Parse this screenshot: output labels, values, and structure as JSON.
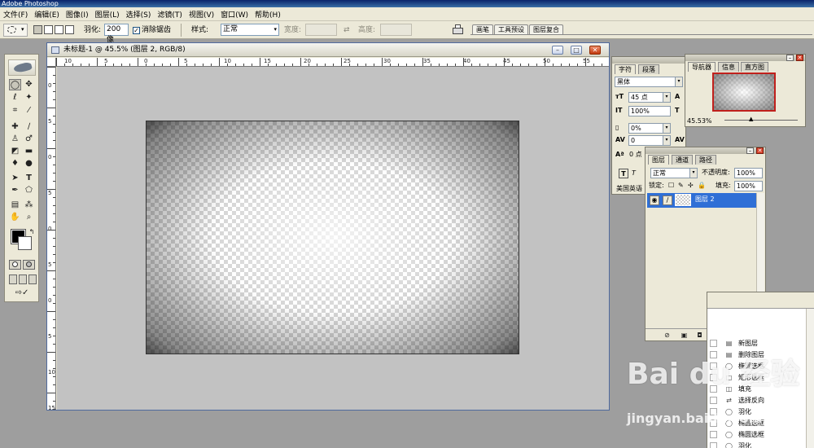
{
  "app": {
    "title": "Adobe Photoshop"
  },
  "menu": [
    "文件(F)",
    "编辑(E)",
    "图像(I)",
    "图层(L)",
    "选择(S)",
    "滤镜(T)",
    "视图(V)",
    "窗口(W)",
    "帮助(H)"
  ],
  "options": {
    "feather_label": "羽化:",
    "feather_value": "200 像",
    "antialias_label": "消除锯齿",
    "style_label": "样式:",
    "style_value": "正常",
    "width_label": "宽度:",
    "height_label": "高度:"
  },
  "palette_well": [
    "画笔",
    "工具预设",
    "图层复合"
  ],
  "document": {
    "title": "未标题-1 @ 45.5% (图层 2, RGB/8)",
    "ruler_h": [
      "10",
      "5",
      "0",
      "5",
      "10",
      "15",
      "20",
      "25",
      "30",
      "35",
      "40",
      "45",
      "50",
      "55",
      "60"
    ],
    "ruler_v": [
      "0",
      "5",
      "0",
      "5",
      "0",
      "5",
      "0",
      "5",
      "10",
      "15",
      "20"
    ]
  },
  "character": {
    "tabs": [
      "字符",
      "段落"
    ],
    "font": "黑体",
    "size": "45 点",
    "scale": "100%",
    "tracking_a": "0%",
    "tracking_b": "0",
    "kerning": "度量标准",
    "baseline": "0 点",
    "language": "美国英语"
  },
  "navigator": {
    "tabs": [
      "导航器",
      "信息",
      "直方图"
    ],
    "zoom": "45.53%"
  },
  "layers": {
    "tabs": [
      "图层",
      "通道",
      "路径"
    ],
    "blend": "正常",
    "opacity_label": "不透明度:",
    "opacity": "100%",
    "lock_label": "锁定:",
    "fill_label": "填充:",
    "fill": "100%",
    "layer_name": "图层 2"
  },
  "history": {
    "items": [
      "新图层",
      "删除图层",
      "椭圆选框",
      "矩形选框",
      "填充",
      "选择反向",
      "羽化",
      "椭圆选框",
      "椭圆选框",
      "羽化"
    ]
  },
  "watermark": {
    "big": "Bai du 经验",
    "small": "jingyan.baidu.com"
  }
}
